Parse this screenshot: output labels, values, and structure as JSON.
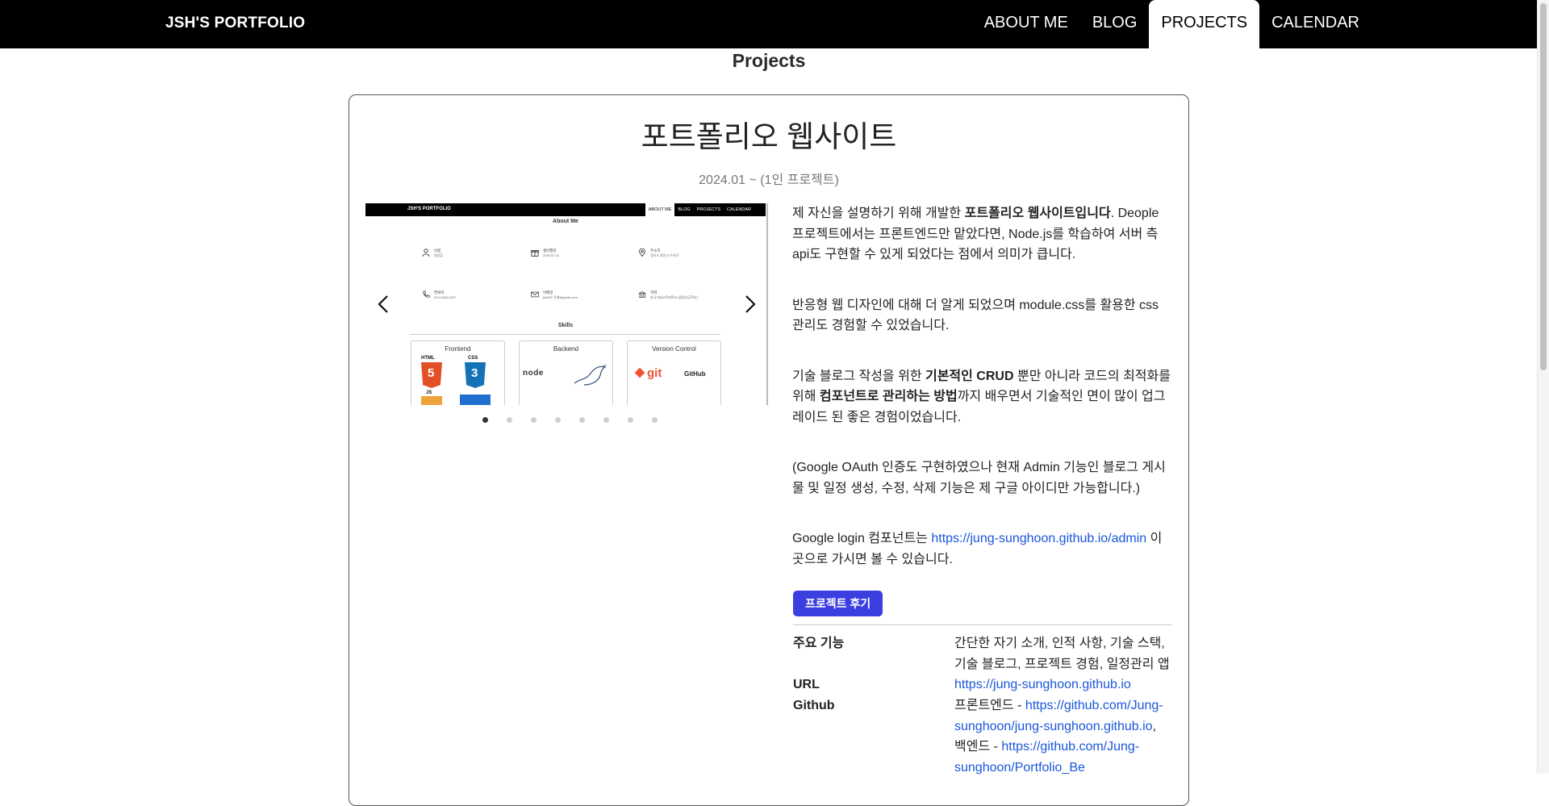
{
  "nav": {
    "brand": "JSH'S PORTFOLIO",
    "links": [
      "ABOUT ME",
      "BLOG",
      "PROJECTS",
      "CALENDAR"
    ],
    "active": "PROJECTS"
  },
  "page": {
    "title": "Projects"
  },
  "project": {
    "title": "포트폴리오 웹사이트",
    "period": "2024.01 ~ (1인 프로젝트)",
    "carousel": {
      "prev_icon": "chevron-left-icon",
      "next_icon": "chevron-right-icon",
      "dot_count": 8,
      "active_dot": 0,
      "preview": {
        "brand": "JSH'S PORTFOLIO",
        "nav": [
          "ABOUT ME",
          "BLOG",
          "PROJECTS",
          "CALENDAR"
        ],
        "heading": "About Me",
        "skills_heading": "Skills",
        "info": [
          {
            "label": "이름",
            "value": "정성훈"
          },
          {
            "label": "생년월일",
            "value": "2000.02.16"
          },
          {
            "label": "주소지",
            "value": "경기도 용인시 수지구"
          },
          {
            "label": "연락처",
            "value": "010-4263-2927"
          },
          {
            "label": "이메일",
            "value": "ju0557 루데@gmail.com"
          },
          {
            "label": "학력",
            "value": "한국기술교육대학교 (컴퓨터공학부)"
          }
        ],
        "skill_groups": [
          "Frontend",
          "Backend",
          "Version Control"
        ],
        "skill_logos": [
          "HTML",
          "CSS",
          "JS",
          "node",
          "git",
          "GitHub"
        ]
      }
    },
    "description": {
      "p1_pre": "제 자신을 설명하기 위해 개발한 ",
      "p1_bold": "포트폴리오 웹사이트입니다",
      "p1_post": ". Deople 프로젝트에서는 프론트엔드만 맡았다면, Node.js를 학습하여 서버 측 api도 구현할 수 있게 되었다는 점에서 의미가 큽니다.",
      "p2": "반응형 웹 디자인에 대해 더 알게 되었으며 module.css를 활용한 css 관리도 경험할 수 있었습니다.",
      "p3_a": "기술 블로그 작성을 위한 ",
      "p3_b": "기본적인 CRUD",
      "p3_c": " 뿐만 아니라 코드의 최적화를 위해 ",
      "p3_d": "컴포넌트로 관리하는 방법",
      "p3_e": "까지 배우면서 기술적인 면이 많이 업그레이드 된 좋은 경험이었습니다.",
      "p4": "(Google OAuth 인증도 구현하였으나 현재 Admin 기능인 블로그 게시물 및 일정 생성, 수정, 삭제 기능은 제 구글 아이디만 가능합니다.)",
      "p5_pre": "Google login 컴포넌트는 ",
      "p5_link": "https://jung-sunghoon.github.io/admin",
      "p5_post": " 이곳으로 가시면 볼 수 있습니다."
    },
    "review_button": "프로젝트 후기",
    "info": {
      "features_label": "주요 기능",
      "features_value": "간단한 자기 소개, 인적 사항, 기술 스택, 기술 블로그, 프로젝트 경험, 일정관리 앱",
      "url_label": "URL",
      "url_value": "https://jung-sunghoon.github.io",
      "github_label": "Github",
      "github_front_prefix": "프론트엔드 - ",
      "github_front_link": "https://github.com/Jung-sunghoon/jung-sunghoon.github.io",
      "github_sep": ",",
      "github_back_prefix": "백엔드 - ",
      "github_back_link": "https://github.com/Jung-sunghoon/Portfolio_Be"
    }
  }
}
